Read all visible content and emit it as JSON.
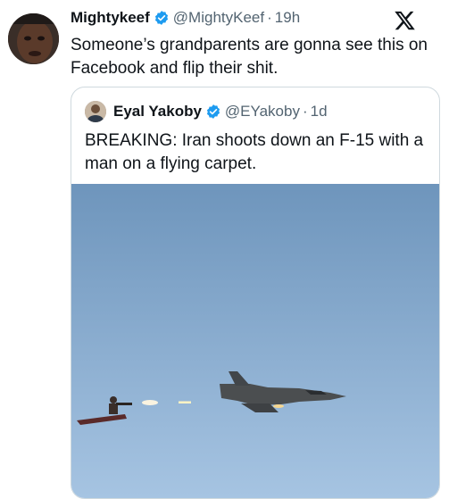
{
  "tweet": {
    "author_name": "Mightykeef",
    "author_handle": "@MightyKeef",
    "separator": "·",
    "time": "19h",
    "text": "Someone’s grandparents are gonna see this on Facebook and flip their shit."
  },
  "quoted": {
    "author_name": "Eyal Yakoby",
    "author_handle": "@EYakoby",
    "separator": "·",
    "time": "1d",
    "text": "BREAKING: Iran shoots down an F-15 with a man on a flying carpet."
  },
  "colors": {
    "verified": "#1d9bf0",
    "text": "#0f1419",
    "muted": "#536471",
    "sky_top": "#6e95bc",
    "sky_bottom": "#9fbfe0"
  },
  "icons": {
    "verified": "verified-badge-icon",
    "logo": "x-logo-icon"
  }
}
